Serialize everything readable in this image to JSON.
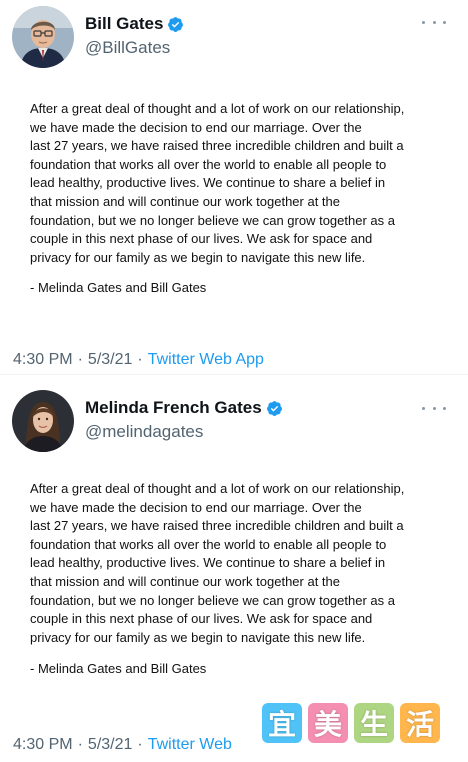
{
  "colors": {
    "text": "#0f1419",
    "secondary": "#536471",
    "link": "#1d9bf0",
    "verified": "#1d9bf0",
    "watermark_tiles": [
      "#4fc3f7",
      "#f48fb1",
      "#aed581",
      "#ffb74d"
    ]
  },
  "tweets": [
    {
      "display_name": "Bill Gates",
      "handle": "@BillGates",
      "verified": true,
      "avatar_icon": "bill-gates-avatar",
      "body": "After a great deal of thought and a lot of work on our relationship,\nwe have made the decision to end our marriage. Over the\nlast 27 years, we have raised three incredible children and built a\nfoundation that works all over the world to enable all people to\nlead healthy, productive lives. We continue to share a belief in\nthat mission and will continue our work together at the\nfoundation, but we no longer believe we can grow together as a\ncouple in this next phase of our lives. We ask for space and\nprivacy for our family as we begin to navigate this new life.",
      "signature": "- Melinda Gates and Bill Gates",
      "time": "4:30 PM",
      "date": "5/3/21",
      "source": "Twitter Web App"
    },
    {
      "display_name": "Melinda French Gates",
      "handle": "@melindagates",
      "verified": true,
      "avatar_icon": "melinda-gates-avatar",
      "body": "After a great deal of thought and a lot of work on our relationship,\nwe have made the decision to end our marriage. Over the\nlast 27 years, we have raised three incredible children and built a\nfoundation that works all over the world to enable all people to\nlead healthy, productive lives. We continue to share a belief in\nthat mission and will continue our work together at the\nfoundation, but we no longer believe we can grow together as a\ncouple in this next phase of our lives. We ask for space and\nprivacy for our family as we begin to navigate this new life.",
      "signature": "- Melinda Gates and Bill Gates",
      "time": "4:30 PM",
      "date": "5/3/21",
      "source": "Twitter Web"
    }
  ],
  "meta_separator": "·",
  "watermark": {
    "chars": [
      "宜",
      "美",
      "生",
      "活"
    ]
  }
}
